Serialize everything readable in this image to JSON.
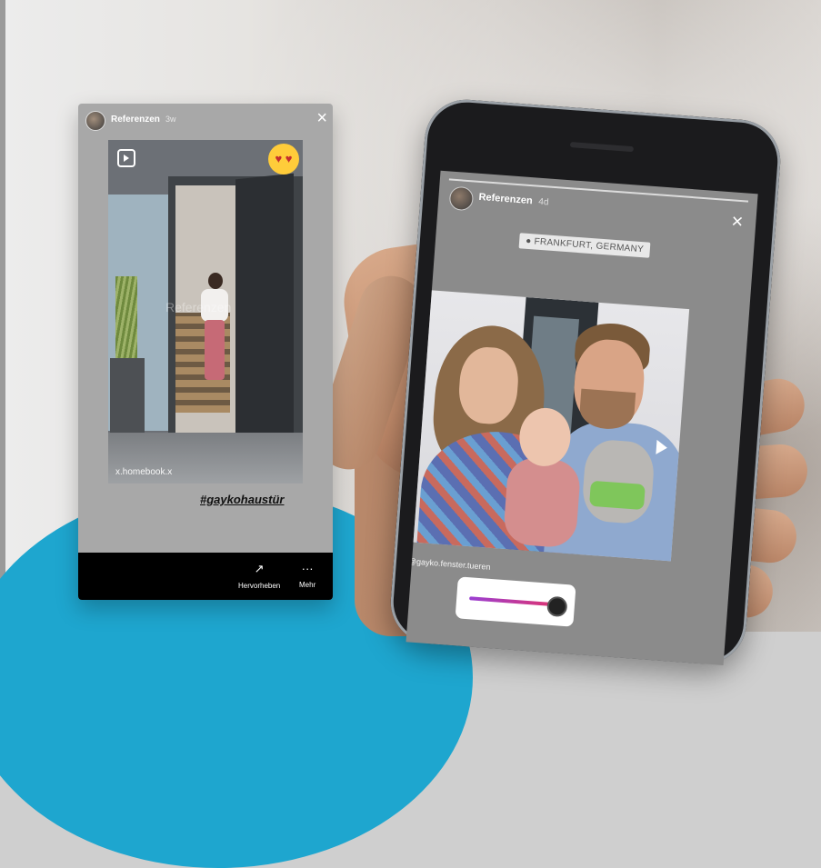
{
  "story_card": {
    "username": "Referenzen",
    "age": "3w",
    "close_icon": "×",
    "watermark": "Referenzen",
    "mention": "x.homebook.x",
    "hashtag": "#gaykohaustür",
    "actions": [
      {
        "label": "Hervorheben",
        "icon": "↗"
      },
      {
        "label": "Mehr",
        "icon": "···"
      }
    ]
  },
  "phone_story": {
    "username": "Referenzen",
    "age": "4d",
    "close_icon": "×",
    "location": "FRANKFURT, GERMANY",
    "mention": "@gayko.fenster.tueren",
    "slider_value": 0.95
  },
  "colors": {
    "accent_blue": "#1ea6cf",
    "slider_gradient_start": "#9a3fd2",
    "slider_gradient_end": "#e2336b"
  }
}
